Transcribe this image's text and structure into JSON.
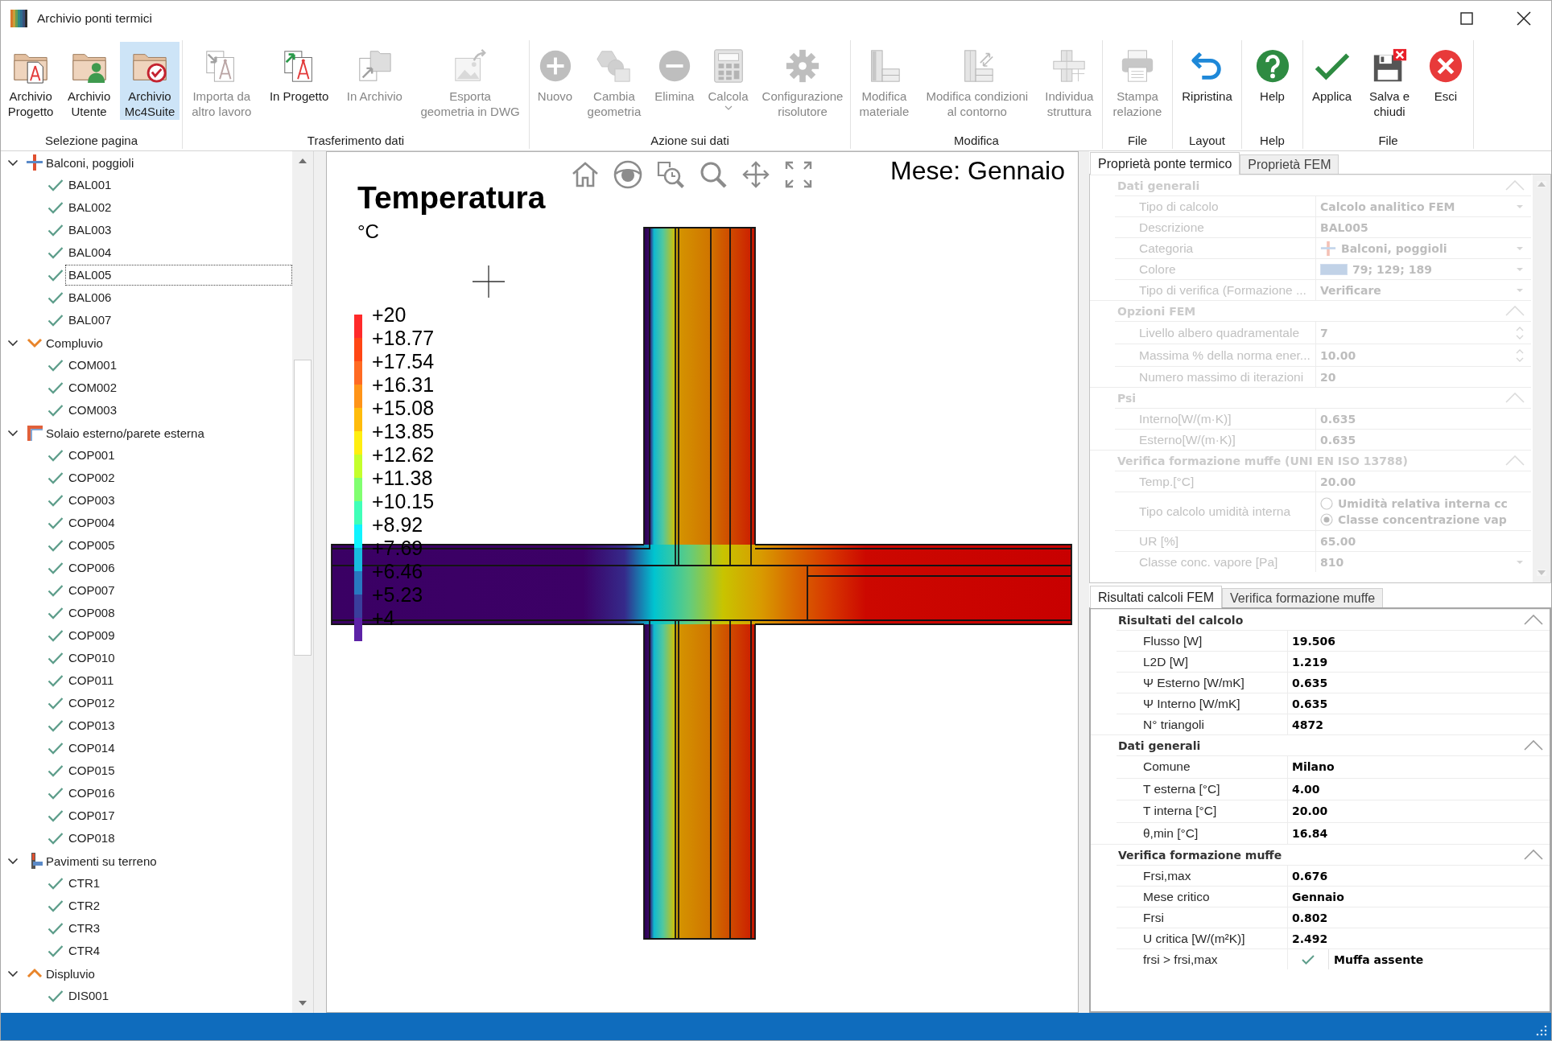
{
  "window": {
    "title": "Archivio ponti termici"
  },
  "ribbon": {
    "groups": [
      {
        "label": "Selezione pagina",
        "buttons": [
          {
            "label": "Archivio\nProgetto",
            "selected": false,
            "disabled": false,
            "dropdown": false
          },
          {
            "label": "Archivio\nUtente",
            "selected": false,
            "disabled": false,
            "dropdown": false
          },
          {
            "label": "Archivio\nMc4Suite",
            "selected": true,
            "disabled": false,
            "dropdown": false
          }
        ]
      },
      {
        "label": "Trasferimento dati",
        "buttons": [
          {
            "label": "Importa da\naltro lavoro",
            "disabled": true,
            "dropdown": false
          },
          {
            "label": "In Progetto",
            "disabled": false,
            "dropdown": false
          },
          {
            "label": "In Archivio",
            "disabled": true,
            "dropdown": false
          },
          {
            "label": "Esporta\ngeometria in DWG",
            "disabled": true,
            "dropdown": false
          }
        ]
      },
      {
        "label": "Azione sui dati",
        "buttons": [
          {
            "label": "Nuovo",
            "disabled": true,
            "dropdown": false
          },
          {
            "label": "Cambia\ngeometria",
            "disabled": true,
            "dropdown": false
          },
          {
            "label": "Elimina",
            "disabled": true,
            "dropdown": false
          },
          {
            "label": "Calcola",
            "disabled": true,
            "dropdown": true
          },
          {
            "label": "Configurazione\nrisolutore",
            "disabled": true,
            "dropdown": false
          }
        ]
      },
      {
        "label": "Modifica",
        "buttons": [
          {
            "label": "Modifica\nmateriale",
            "disabled": true,
            "dropdown": false
          },
          {
            "label": "Modifica condizioni\nal contorno",
            "disabled": true,
            "dropdown": false
          },
          {
            "label": "Individua\nstruttura",
            "disabled": true,
            "dropdown": false
          }
        ]
      },
      {
        "label": "File",
        "buttons": [
          {
            "label": "Stampa\nrelazione",
            "disabled": true,
            "dropdown": false
          }
        ]
      },
      {
        "label": "Layout",
        "buttons": [
          {
            "label": "Ripristina",
            "disabled": false,
            "dropdown": false
          }
        ]
      },
      {
        "label": "Help",
        "buttons": [
          {
            "label": "Help",
            "disabled": false,
            "dropdown": false
          }
        ]
      },
      {
        "label": "File",
        "buttons": [
          {
            "label": "Applica",
            "disabled": false,
            "dropdown": false
          },
          {
            "label": "Salva e\nchiudi",
            "disabled": false,
            "dropdown": false
          },
          {
            "label": "Esci",
            "disabled": false,
            "dropdown": false
          }
        ]
      }
    ]
  },
  "tree": {
    "categories": [
      {
        "label": "Balconi, poggioli",
        "expanded": true,
        "children": [
          {
            "label": "BAL001",
            "calculated": true,
            "selected": false
          },
          {
            "label": "BAL002",
            "calculated": true,
            "selected": false
          },
          {
            "label": "BAL003",
            "calculated": true,
            "selected": false
          },
          {
            "label": "BAL004",
            "calculated": true,
            "selected": false
          },
          {
            "label": "BAL005",
            "calculated": true,
            "selected": true
          },
          {
            "label": "BAL006",
            "calculated": true,
            "selected": false
          },
          {
            "label": "BAL007",
            "calculated": true,
            "selected": false
          }
        ]
      },
      {
        "label": "Compluvio",
        "expanded": true,
        "children": [
          {
            "label": "COM001",
            "calculated": true,
            "selected": false
          },
          {
            "label": "COM002",
            "calculated": true,
            "selected": false
          },
          {
            "label": "COM003",
            "calculated": true,
            "selected": false
          }
        ]
      },
      {
        "label": "Solaio esterno/parete esterna",
        "expanded": true,
        "children": [
          {
            "label": "COP001",
            "calculated": true,
            "selected": false
          },
          {
            "label": "COP002",
            "calculated": true,
            "selected": false
          },
          {
            "label": "COP003",
            "calculated": true,
            "selected": false
          },
          {
            "label": "COP004",
            "calculated": true,
            "selected": false
          },
          {
            "label": "COP005",
            "calculated": true,
            "selected": false
          },
          {
            "label": "COP006",
            "calculated": true,
            "selected": false
          },
          {
            "label": "COP007",
            "calculated": true,
            "selected": false
          },
          {
            "label": "COP008",
            "calculated": true,
            "selected": false
          },
          {
            "label": "COP009",
            "calculated": true,
            "selected": false
          },
          {
            "label": "COP010",
            "calculated": true,
            "selected": false
          },
          {
            "label": "COP011",
            "calculated": true,
            "selected": false
          },
          {
            "label": "COP012",
            "calculated": true,
            "selected": false
          },
          {
            "label": "COP013",
            "calculated": true,
            "selected": false
          },
          {
            "label": "COP014",
            "calculated": true,
            "selected": false
          },
          {
            "label": "COP015",
            "calculated": true,
            "selected": false
          },
          {
            "label": "COP016",
            "calculated": true,
            "selected": false
          },
          {
            "label": "COP017",
            "calculated": true,
            "selected": false
          },
          {
            "label": "COP018",
            "calculated": true,
            "selected": false
          }
        ]
      },
      {
        "label": "Pavimenti su terreno",
        "expanded": true,
        "children": [
          {
            "label": "CTR1",
            "calculated": true,
            "selected": false
          },
          {
            "label": "CTR2",
            "calculated": true,
            "selected": false
          },
          {
            "label": "CTR3",
            "calculated": true,
            "selected": false
          },
          {
            "label": "CTR4",
            "calculated": true,
            "selected": false
          }
        ]
      },
      {
        "label": "Displuvio",
        "expanded": true,
        "children": [
          {
            "label": "DIS001",
            "calculated": true,
            "selected": false
          }
        ]
      }
    ]
  },
  "viewer": {
    "title": "Temperatura",
    "unit": "°C",
    "month": "Mese: Gennaio",
    "legend": [
      {
        "label": "+20",
        "color": "#ff2a2a"
      },
      {
        "label": "+18.77",
        "color": "#ff4614"
      },
      {
        "label": "+17.54",
        "color": "#ff6a22"
      },
      {
        "label": "+16.31",
        "color": "#ff9418"
      },
      {
        "label": "+15.08",
        "color": "#ffbc0c"
      },
      {
        "label": "+13.85",
        "color": "#ffee10"
      },
      {
        "label": "+12.62",
        "color": "#c4ff2c"
      },
      {
        "label": "+11.38",
        "color": "#80ff70"
      },
      {
        "label": "+10.15",
        "color": "#40ffb8"
      },
      {
        "label": "+8.92",
        "color": "#10f4ff"
      },
      {
        "label": "+7.69",
        "color": "#18bce0"
      },
      {
        "label": "+6.46",
        "color": "#2878c0"
      },
      {
        "label": "+5.23",
        "color": "#3a3e9c"
      },
      {
        "label": "+4",
        "color": "#5c22a6"
      }
    ]
  },
  "properties": {
    "tabs": [
      {
        "label": "Proprietà ponte termico",
        "selected": true
      },
      {
        "label": "Proprietà FEM",
        "selected": false
      }
    ],
    "disabled": true,
    "sections": [
      {
        "title": "Dati generali",
        "expanded": true,
        "rows": [
          {
            "name": "Tipo di calcolo",
            "value": "Calcolo analitico FEM",
            "kind": "dropdown"
          },
          {
            "name": "Descrizione",
            "value": "BAL005",
            "kind": "text"
          },
          {
            "name": "Categoria",
            "value": "Balconi, poggioli",
            "kind": "category"
          },
          {
            "name": "Colore",
            "value": "79; 129; 189",
            "kind": "color"
          },
          {
            "name": "Tipo di verifica (Formazione ...",
            "value": "Verificare",
            "kind": "dropdown"
          }
        ]
      },
      {
        "title": "Opzioni FEM",
        "expanded": true,
        "rows": [
          {
            "name": "Livello albero quadramentale",
            "value": "7",
            "kind": "spinner"
          },
          {
            "name": "Massima % della norma ener...",
            "value": "10.00",
            "kind": "spinner"
          },
          {
            "name": "Numero massimo di iterazioni",
            "value": "20",
            "kind": "text"
          }
        ]
      },
      {
        "title": "Psi",
        "expanded": true,
        "rows": [
          {
            "name": "Interno[W/(m·K)]",
            "value": "0.635",
            "kind": "text"
          },
          {
            "name": "Esterno[W/(m·K)]",
            "value": "0.635",
            "kind": "text"
          }
        ]
      },
      {
        "title": "Verifica formazione muffe (UNI EN ISO 13788)",
        "expanded": true,
        "rows": [
          {
            "name": "Temp.[°C]",
            "value": "20.00",
            "kind": "text"
          },
          {
            "name": "Tipo calcolo umidità interna",
            "kind": "radio",
            "options": [
              {
                "label": "Umidità relativa interna cc",
                "selected": false
              },
              {
                "label": "Classe concentrazione vap",
                "selected": true
              }
            ]
          },
          {
            "name": "UR [%]",
            "value": "65.00",
            "kind": "text"
          },
          {
            "name": "Classe conc. vapore [Pa]",
            "value": "810",
            "kind": "dropdown"
          }
        ]
      }
    ]
  },
  "results": {
    "tabs": [
      {
        "label": "Risultati calcoli FEM",
        "selected": true
      },
      {
        "label": "Verifica formazione muffe",
        "selected": false
      }
    ],
    "sections": [
      {
        "title": "Risultati del calcolo",
        "expanded": true,
        "rows": [
          {
            "name": "Flusso [W]",
            "value": "19.506",
            "kind": "text"
          },
          {
            "name": "L2D [W]",
            "value": "1.219",
            "kind": "text"
          },
          {
            "name": "Ψ Esterno [W/mK]",
            "value": "0.635",
            "kind": "text"
          },
          {
            "name": "Ψ Interno [W/mK]",
            "value": "0.635",
            "kind": "text"
          },
          {
            "name": "N° triangoli",
            "value": "4872",
            "kind": "text"
          }
        ]
      },
      {
        "title": "Dati generali",
        "expanded": true,
        "rows": [
          {
            "name": "Comune",
            "value": "Milano",
            "kind": "text"
          },
          {
            "name": "T esterna [°C]",
            "value": "4.00",
            "kind": "text"
          },
          {
            "name": "T interna [°C]",
            "value": "20.00",
            "kind": "text"
          },
          {
            "name": "θ,min [°C]",
            "value": "16.84",
            "kind": "text"
          }
        ]
      },
      {
        "title": "Verifica formazione muffe",
        "expanded": true,
        "rows": [
          {
            "name": "Frsi,max",
            "value": "0.676",
            "kind": "text"
          },
          {
            "name": "Mese critico",
            "value": "Gennaio",
            "kind": "text"
          },
          {
            "name": "Frsi",
            "value": "0.802",
            "kind": "text"
          },
          {
            "name": "U critica [W/(m²K)]",
            "value": "2.492",
            "kind": "text"
          },
          {
            "name": "frsi > frsi,max",
            "value": "Muffa assente",
            "kind": "status",
            "passed": true
          }
        ]
      }
    ]
  }
}
